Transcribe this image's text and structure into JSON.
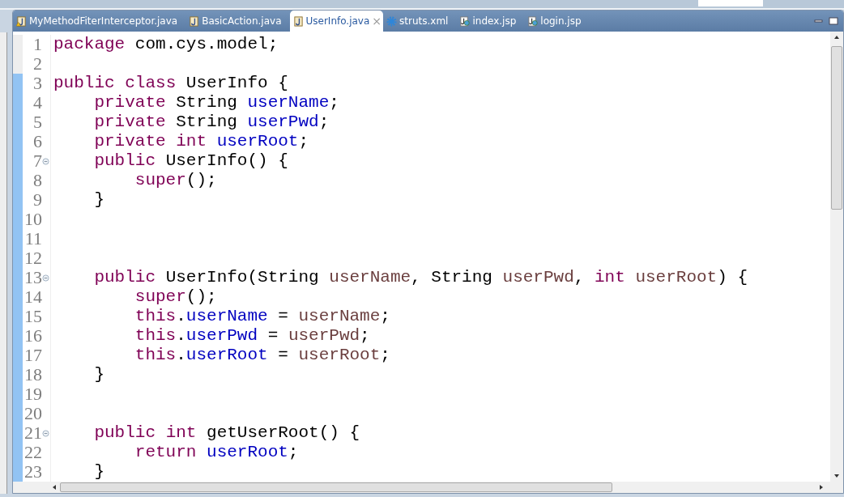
{
  "tabs": [
    {
      "label": "MyMethodFiterInterceptor.java",
      "kind": "java",
      "warning": true,
      "selected": false
    },
    {
      "label": "BasicAction.java",
      "kind": "java",
      "selected": false
    },
    {
      "label": "UserInfo.java",
      "kind": "java",
      "selected": true,
      "close": "×"
    },
    {
      "label": "struts.xml",
      "kind": "xml",
      "selected": false
    },
    {
      "label": "index.jsp",
      "kind": "jsp",
      "selected": false
    },
    {
      "label": "login.jsp",
      "kind": "jsp",
      "selected": false
    }
  ],
  "lines": [
    {
      "number": "1",
      "marked": false,
      "tokens": [
        {
          "text": "package",
          "kind": "kw"
        },
        {
          "text": " com.cys.model;",
          "kind": "plain"
        }
      ]
    },
    {
      "number": "2",
      "marked": false
    },
    {
      "number": "3",
      "marked": true,
      "tokens": [
        {
          "text": "public",
          "kind": "kw"
        },
        {
          "text": " class",
          "kind": "kw"
        },
        {
          "text": " UserInfo {",
          "kind": "plain"
        }
      ]
    },
    {
      "number": "4",
      "marked": true,
      "tokens": [
        {
          "text": "    private",
          "kind": "kw"
        },
        {
          "text": " String ",
          "kind": "plain"
        },
        {
          "text": "userName",
          "kind": "field"
        },
        {
          "text": ";",
          "kind": "plain"
        }
      ]
    },
    {
      "number": "5",
      "marked": true,
      "tokens": [
        {
          "text": "    private",
          "kind": "kw"
        },
        {
          "text": " String ",
          "kind": "plain"
        },
        {
          "text": "userPwd",
          "kind": "field"
        },
        {
          "text": ";",
          "kind": "plain"
        }
      ]
    },
    {
      "number": "6",
      "marked": true,
      "tokens": [
        {
          "text": "    private",
          "kind": "kw"
        },
        {
          "text": " int",
          "kind": "kw"
        },
        {
          "text": " userRoot",
          "kind": "field"
        },
        {
          "text": ";",
          "kind": "plain"
        }
      ]
    },
    {
      "number": "7",
      "fold": true,
      "marked": true,
      "tokens": [
        {
          "text": "    public",
          "kind": "kw"
        },
        {
          "text": " UserInfo() {",
          "kind": "plain"
        }
      ]
    },
    {
      "number": "8",
      "marked": true,
      "tokens": [
        {
          "text": "        super",
          "kind": "kw"
        },
        {
          "text": "();",
          "kind": "plain"
        }
      ]
    },
    {
      "number": "9",
      "marked": true,
      "tokens": [
        {
          "text": "    }",
          "kind": "plain"
        }
      ]
    },
    {
      "number": "10",
      "marked": true
    },
    {
      "number": "11",
      "marked": true
    },
    {
      "number": "12",
      "marked": true
    },
    {
      "number": "13",
      "fold": true,
      "marked": true,
      "tokens": [
        {
          "text": "    public",
          "kind": "kw"
        },
        {
          "text": " UserInfo(String ",
          "kind": "plain"
        },
        {
          "text": "userName",
          "kind": "param"
        },
        {
          "text": ", String ",
          "kind": "plain"
        },
        {
          "text": "userPwd",
          "kind": "param"
        },
        {
          "text": ", ",
          "kind": "plain"
        },
        {
          "text": "int",
          "kind": "kw"
        },
        {
          "text": " userRoot",
          "kind": "param"
        },
        {
          "text": ") {",
          "kind": "plain"
        }
      ]
    },
    {
      "number": "14",
      "marked": true,
      "tokens": [
        {
          "text": "        super",
          "kind": "kw"
        },
        {
          "text": "();",
          "kind": "plain"
        }
      ]
    },
    {
      "number": "15",
      "marked": true,
      "tokens": [
        {
          "text": "        this",
          "kind": "kw"
        },
        {
          "text": ".",
          "kind": "plain"
        },
        {
          "text": "userName",
          "kind": "field"
        },
        {
          "text": " = ",
          "kind": "plain"
        },
        {
          "text": "userName",
          "kind": "param"
        },
        {
          "text": ";",
          "kind": "plain"
        }
      ]
    },
    {
      "number": "16",
      "marked": true,
      "tokens": [
        {
          "text": "        this",
          "kind": "kw"
        },
        {
          "text": ".",
          "kind": "plain"
        },
        {
          "text": "userPwd",
          "kind": "field"
        },
        {
          "text": " = ",
          "kind": "plain"
        },
        {
          "text": "userPwd",
          "kind": "param"
        },
        {
          "text": ";",
          "kind": "plain"
        }
      ]
    },
    {
      "number": "17",
      "marked": true,
      "tokens": [
        {
          "text": "        this",
          "kind": "kw"
        },
        {
          "text": ".",
          "kind": "plain"
        },
        {
          "text": "userRoot",
          "kind": "field"
        },
        {
          "text": " = ",
          "kind": "plain"
        },
        {
          "text": "userRoot",
          "kind": "param"
        },
        {
          "text": ";",
          "kind": "plain"
        }
      ]
    },
    {
      "number": "18",
      "marked": true,
      "tokens": [
        {
          "text": "    }",
          "kind": "plain"
        }
      ]
    },
    {
      "number": "19",
      "marked": true
    },
    {
      "number": "20",
      "marked": true
    },
    {
      "number": "21",
      "fold": true,
      "marked": true,
      "tokens": [
        {
          "text": "    public",
          "kind": "kw"
        },
        {
          "text": " int",
          "kind": "kw"
        },
        {
          "text": " getUserRoot() {",
          "kind": "plain"
        }
      ]
    },
    {
      "number": "22",
      "marked": true,
      "tokens": [
        {
          "text": "        return",
          "kind": "kw"
        },
        {
          "text": " userRoot",
          "kind": "field"
        },
        {
          "text": ";",
          "kind": "plain"
        }
      ]
    },
    {
      "number": "23",
      "marked": true,
      "tokens": [
        {
          "text": "    }",
          "kind": "plain"
        }
      ]
    }
  ]
}
